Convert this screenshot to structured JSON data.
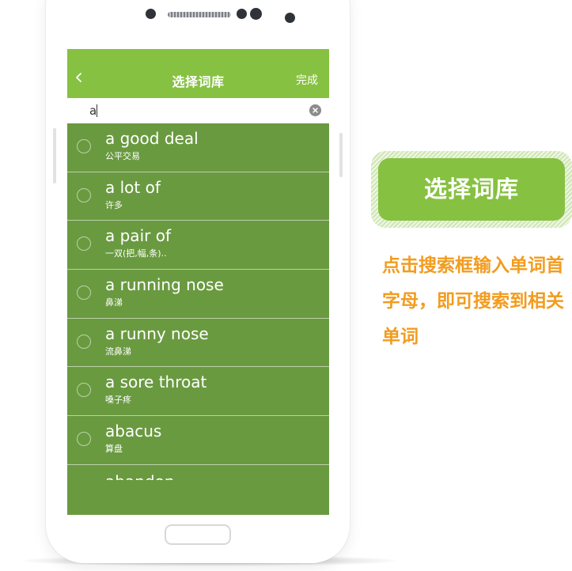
{
  "header": {
    "title": "选择词库",
    "done_label": "完成"
  },
  "search": {
    "value": "a"
  },
  "words": [
    {
      "word": "a good deal",
      "meaning": "公平交易"
    },
    {
      "word": "a lot of",
      "meaning": "许多"
    },
    {
      "word": "a pair of",
      "meaning": "一双(把,幅,条).."
    },
    {
      "word": "a running nose",
      "meaning": "鼻涕"
    },
    {
      "word": "a runny nose",
      "meaning": "流鼻涕"
    },
    {
      "word": "a sore throat",
      "meaning": "嗓子疼"
    },
    {
      "word": "abacus",
      "meaning": "算盘"
    },
    {
      "word": "abandon",
      "meaning": ""
    }
  ],
  "promo": {
    "badge": "选择词库",
    "hint": "点击搜索框输入单词首字母，即可搜索到相关单词"
  },
  "colors": {
    "accent_green": "#86c141",
    "list_green": "#6a9a40",
    "hint_orange": "#f29c1f"
  },
  "icons": [
    "back-icon",
    "clear-icon",
    "radio-icon"
  ]
}
